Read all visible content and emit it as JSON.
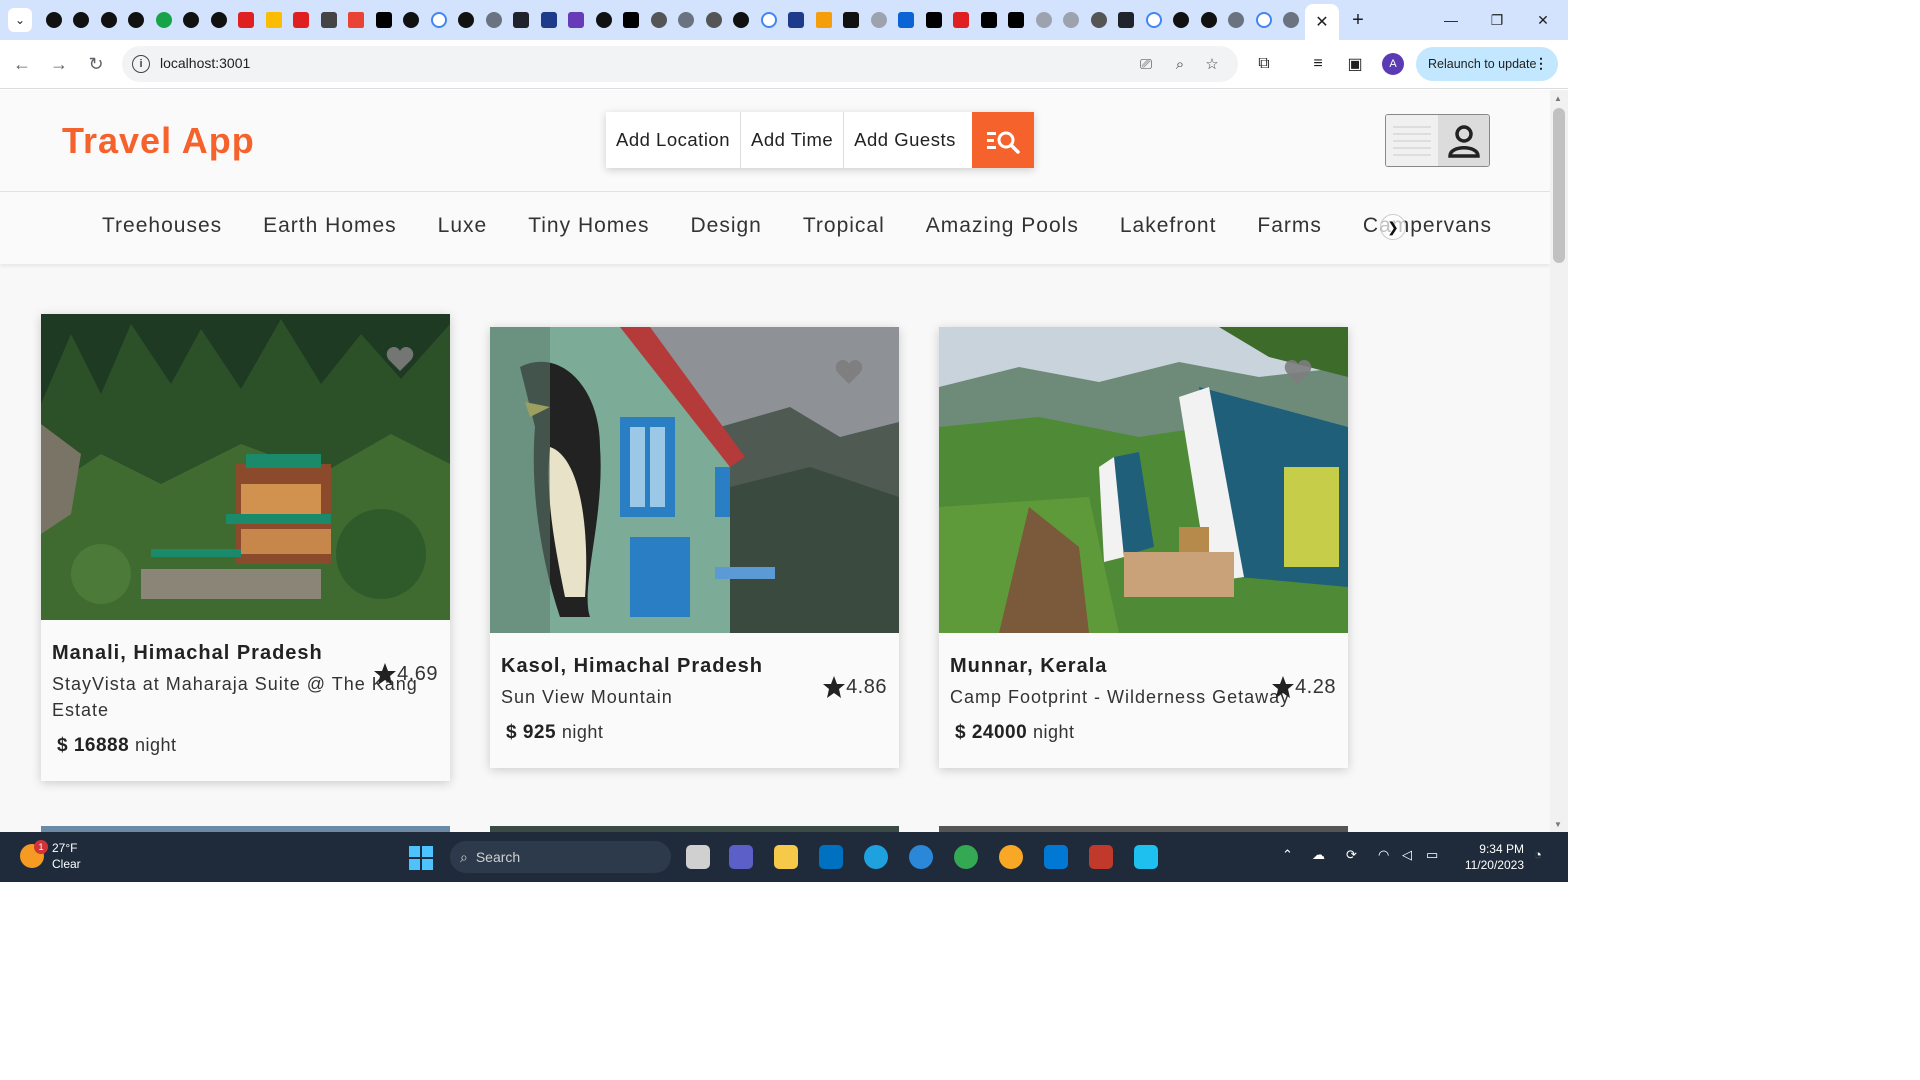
{
  "browser": {
    "url": "localhost:3001",
    "relaunch_label": "Relaunch to update",
    "profile_initial": "A"
  },
  "app": {
    "logo": "Travel App",
    "search": {
      "location": "Add Location",
      "time": "Add Time",
      "guests": "Add Guests"
    },
    "categories": [
      "Treehouses",
      "Earth Homes",
      "Luxe",
      "Tiny Homes",
      "Design",
      "Tropical",
      "Amazing Pools",
      "Lakefront",
      "Farms",
      "Campervans"
    ],
    "listings": [
      {
        "location": "Manali, Himachal Pradesh",
        "rating": "4.69",
        "name": "StayVista at Maharaja Suite @ The Kang Estate",
        "currency": "$",
        "price": "16888",
        "per": "night"
      },
      {
        "location": "Kasol, Himachal Pradesh",
        "rating": "4.86",
        "name": "Sun View Mountain",
        "currency": "$",
        "price": "925",
        "per": "night"
      },
      {
        "location": "Munnar, Kerala",
        "rating": "4.28",
        "name": "Camp Footprint - Wilderness Getaway",
        "currency": "$",
        "price": "24000",
        "per": "night"
      }
    ]
  },
  "taskbar": {
    "weather_temp": "27°F",
    "weather_cond": "Clear",
    "weather_badge": "1",
    "search_placeholder": "Search",
    "time": "9:34 PM",
    "date": "11/20/2023"
  },
  "colors": {
    "accent": "#f5622c",
    "taskbar": "#1f2b3a"
  }
}
